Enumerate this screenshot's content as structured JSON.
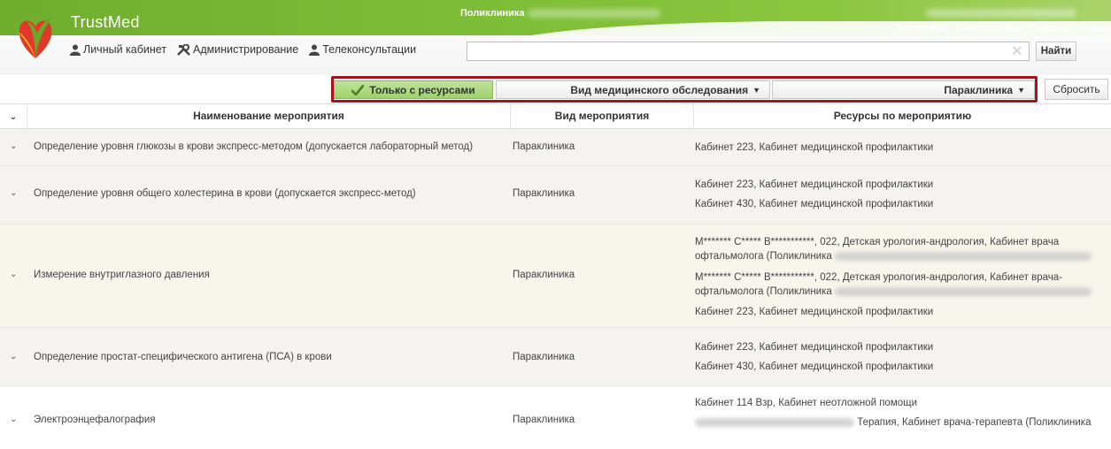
{
  "header": {
    "app_title": "TrustMed",
    "org_name": "Поликлиника",
    "links": [
      "Настройки",
      "Очистить кеш",
      "Помощь",
      "Выход"
    ],
    "nav": [
      {
        "label": "Личный кабинет",
        "icon": "user-icon"
      },
      {
        "label": "Администрирование",
        "icon": "tools-icon"
      },
      {
        "label": "Телеконсультации",
        "icon": "user-icon"
      }
    ],
    "search": {
      "value": "",
      "placeholder": "",
      "button": "Найти"
    }
  },
  "filters": {
    "only_with_resources": "Только с ресурсами",
    "exam_type": "Вид медицинского обследования",
    "paraclinic": "Параклиника",
    "reset": "Сбросить"
  },
  "table": {
    "columns": [
      "Наименование мероприятия",
      "Вид мероприятия",
      "Ресурсы по мероприятию"
    ],
    "rows": [
      {
        "name": "Определение уровня глюкозы в крови экспресс-методом (допускается лабораторный метод)",
        "type": "Параклиника",
        "resources": [
          "Кабинет 223, Кабинет медицинской профилактики"
        ]
      },
      {
        "name": "Определение уровня общего холестерина в крови (допускается экспресс-метод)",
        "type": "Параклиника",
        "resources": [
          "Кабинет 223, Кабинет медицинской профилактики",
          "Кабинет 430, Кабинет медицинской профилактики"
        ]
      },
      {
        "name": "Измерение внутриглазного давления",
        "type": "Параклиника",
        "resources": [
          "М******* С***** В***********, 022, Детская урология-андрология, Кабинет врача офтальмолога (Поликлиника",
          "М******* С***** В***********, 022, Детская урология-андрология, Кабинет врача-офтальмолога (Поликлиника",
          "Кабинет 223, Кабинет медицинской профилактики"
        ]
      },
      {
        "name": "Определение простат-специфического антигена (ПСА) в крови",
        "type": "Параклиника",
        "resources": [
          "Кабинет 223, Кабинет медицинской профилактики",
          "Кабинет 430, Кабинет медицинской профилактики"
        ]
      },
      {
        "name": "Электроэнцефалография",
        "type": "Параклиника",
        "resources": [
          "Кабинет 114 Взр, Кабинет неотложной помощи",
          "Терапия, Кабинет врача-терапевта (Поликлиника"
        ]
      }
    ]
  },
  "colors": {
    "brand_green": "#7cbc36",
    "highlight_border": "#a3141c",
    "active_filter": "#a9d67a"
  }
}
